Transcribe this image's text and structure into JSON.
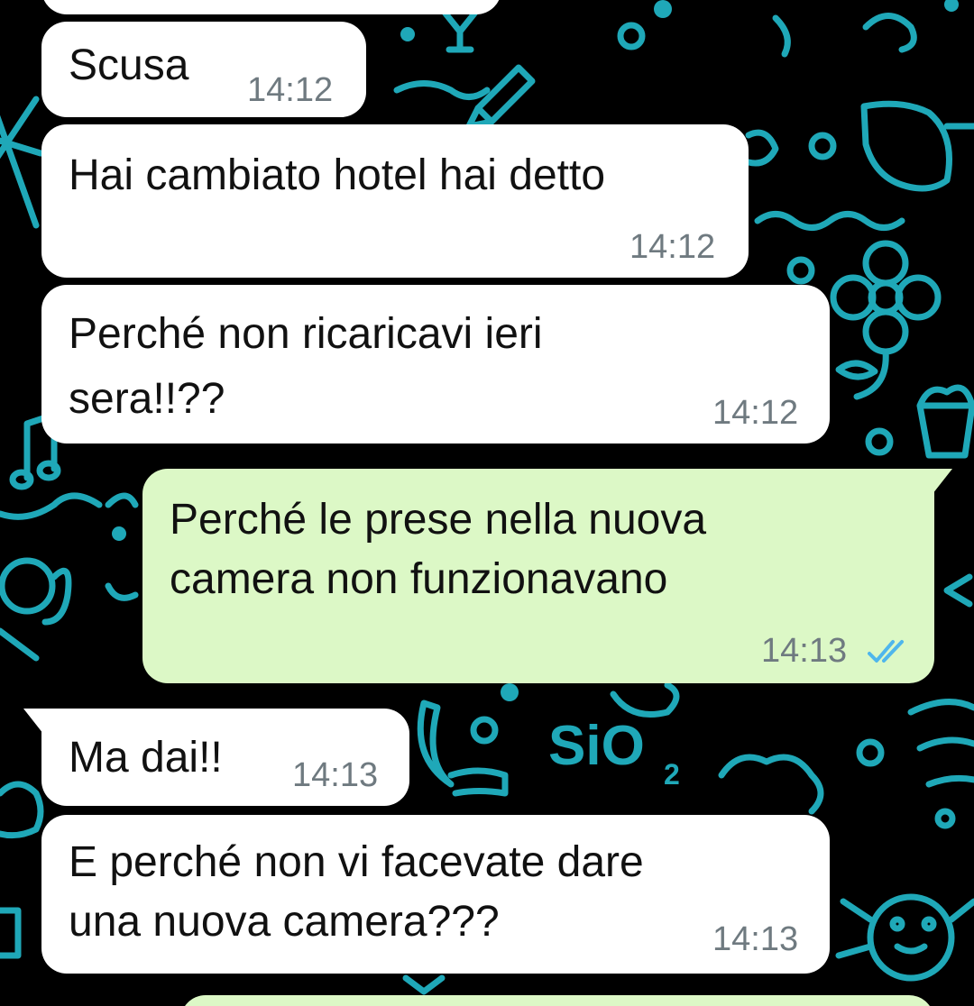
{
  "messages": [
    {
      "direction": "incoming",
      "text": "Scusa",
      "time": "14:12"
    },
    {
      "direction": "incoming",
      "text": "Hai cambiato hotel hai detto",
      "time": "14:12"
    },
    {
      "direction": "incoming",
      "text_lines": [
        "Perché non ricaricavi ieri",
        "sera!!??"
      ],
      "time": "14:12"
    },
    {
      "direction": "outgoing",
      "text_lines": [
        "Perché le prese nella nuova",
        "camera non funzionavano"
      ],
      "time": "14:13",
      "status": "read",
      "status_icon": "double-check-icon"
    },
    {
      "direction": "incoming",
      "text": "Ma dai!!",
      "time": "14:13"
    },
    {
      "direction": "incoming",
      "text_lines": [
        "E perché non vi facevate dare",
        "una nuova camera???"
      ],
      "time": "14:13"
    }
  ],
  "wallpaper": {
    "label": "SiO",
    "label_subscript": "2",
    "doodle_color": "#1fa8b8"
  },
  "colors": {
    "incoming_bubble": "#ffffff",
    "outgoing_bubble": "#dcf8c6",
    "read_ticks": "#4fb6ec",
    "timestamp": "#6f7a80"
  }
}
